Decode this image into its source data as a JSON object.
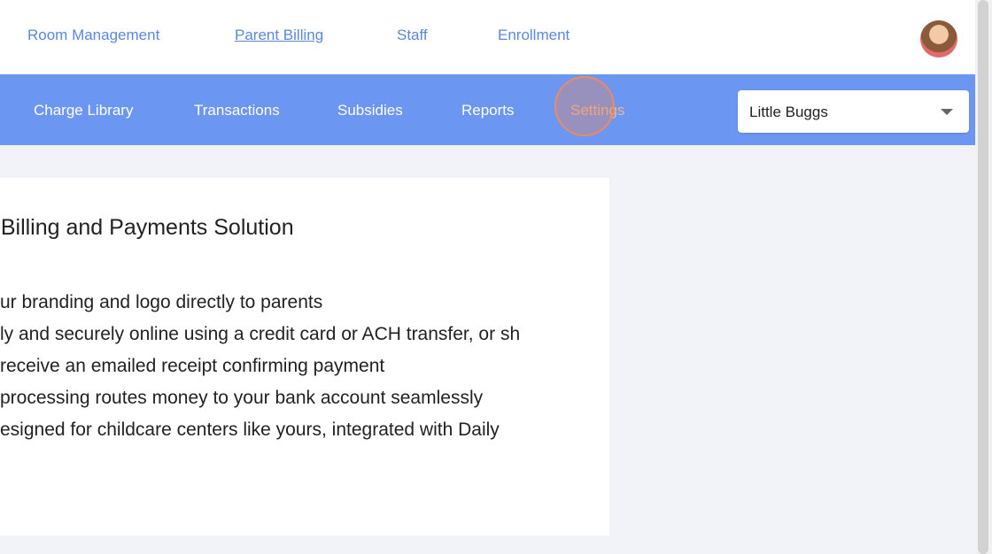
{
  "topnav": {
    "items": [
      {
        "label": "Room Management"
      },
      {
        "label": "Parent Billing"
      },
      {
        "label": "Staff"
      },
      {
        "label": "Enrollment"
      }
    ]
  },
  "subnav": {
    "items": [
      {
        "label": "Charge Library"
      },
      {
        "label": "Transactions"
      },
      {
        "label": "Subsidies"
      },
      {
        "label": "Reports"
      },
      {
        "label": "Settings"
      }
    ],
    "location_select": {
      "value": "Little Buggs"
    }
  },
  "card": {
    "title": "e Billing and Payments Solution",
    "features": [
      "ur branding and logo directly to parents",
      "ly and securely online using a credit card or ACH transfer, or sh",
      "receive an emailed receipt confirming payment",
      "processing routes money to your bank account seamlessly",
      "esigned for childcare centers like yours, integrated with Daily"
    ]
  },
  "colors": {
    "accent": "#6b96f2",
    "link": "#5b87e0",
    "click_indicator": "#f08a5d"
  },
  "icons": {
    "avatar": "user-avatar-photo",
    "dropdown": "chevron-down-icon"
  }
}
